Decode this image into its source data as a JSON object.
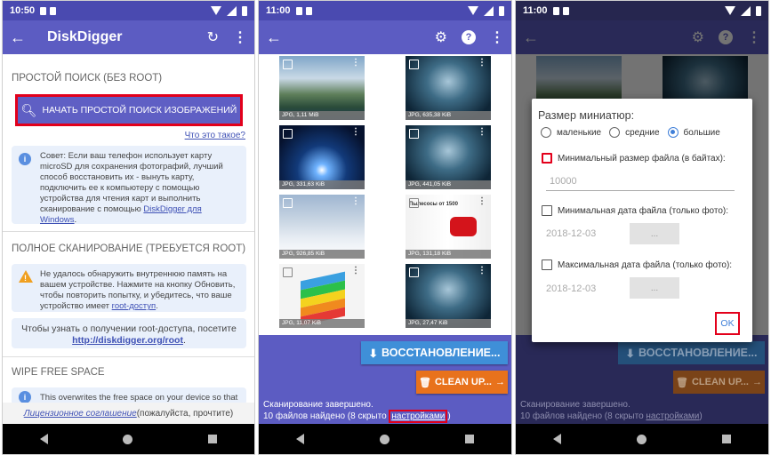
{
  "colors": {
    "primary": "#5c5cc2",
    "primary_dark": "#4a4ab0",
    "accent_blue": "#3f8fd8",
    "accent_orange": "#e8721c",
    "highlight_red": "#e3001b"
  },
  "screen1": {
    "status": {
      "time": "10:50"
    },
    "appbar": {
      "title": "DiskDigger"
    },
    "simple_scan": {
      "heading": "ПРОСТОЙ ПОИСК (БЕЗ ROOT)",
      "button": "НАЧАТЬ ПРОСТОЙ ПОИСК ИЗОБРАЖЕНИЙ",
      "what_is_this": "Что это такое?",
      "tip_text": "Совет: Если ваш телефон использует карту microSD для сохранения фотографий, лучший способ восстановить их - вынуть карту, подключить ее к компьютеру с помощью устройства для чтения карт и выполнить сканирование с помощью ",
      "tip_link": "DiskDigger для Windows",
      "tip_end": "."
    },
    "full_scan": {
      "heading": "ПОЛНОЕ СКАНИРОВАНИЕ (ТРЕБУЕТСЯ ROOT)",
      "warn_text": "Не удалось обнаружить внутреннюю память на вашем устройстве. Нажмите на кнопку Обновить, чтобы повторить попытку, и убедитесь, что ваше устройство имеет ",
      "warn_link": "root-доступ",
      "warn_end": ".",
      "root_info": "Чтобы узнать о получении root-доступа, посетите",
      "root_link": "http://diskdigger.org/root",
      "root_end": "."
    },
    "wipe": {
      "heading": "WIPE FREE SPACE",
      "text": "This overwrites the free space on your device so that"
    },
    "footer": {
      "link": "Лицензионное соглашение",
      "text": " (пожалуйста, прочтите)"
    }
  },
  "screen2": {
    "status": {
      "time": "11:00"
    },
    "thumbs": [
      {
        "caption": "JPG, 1,11 MiB"
      },
      {
        "caption": "JPG, 635,38 KiB"
      },
      {
        "caption": "JPG, 331,63 KiB"
      },
      {
        "caption": "JPG, 441,05 KiB"
      },
      {
        "caption": "JPG, 926,85 KiB"
      },
      {
        "caption": "JPG, 131,18 KiB"
      },
      {
        "caption": "JPG, 11,07 KiB"
      },
      {
        "caption": "JPG, 27,47 KiB"
      }
    ],
    "vac_tag": "Пылесосы от 1500",
    "restore_button": "ВОССТАНОВЛЕНИЕ...",
    "clean_button": "CLEAN UP...",
    "status_line1": "Сканирование завершено.",
    "status_line2": "10 файлов найдено (8 скрыто ",
    "settings_link": "настройками",
    "status_end": ")"
  },
  "screen3": {
    "status": {
      "time": "11:00"
    },
    "dialog": {
      "title": "Размер миниатюр:",
      "size_small": "маленькие",
      "size_medium": "средние",
      "size_large": "большие",
      "min_size_label": "Минимальный размер файла (в байтах):",
      "min_size_value": "10000",
      "min_date_label": "Минимальная дата файла (только фото):",
      "min_date_value": "2018-12-03",
      "max_date_label": "Максимальная дата файла (только фото):",
      "max_date_value": "2018-12-03",
      "dots_button": "...",
      "ok_button": "OK"
    },
    "restore_button": "ВОССТАНОВЛЕНИЕ...",
    "clean_button": "CLEAN UP...",
    "status_line1": "Сканирование завершено.",
    "status_line2": "10 файлов найдено (8 скрыто ",
    "settings_link": "настройками",
    "status_end": ")"
  }
}
